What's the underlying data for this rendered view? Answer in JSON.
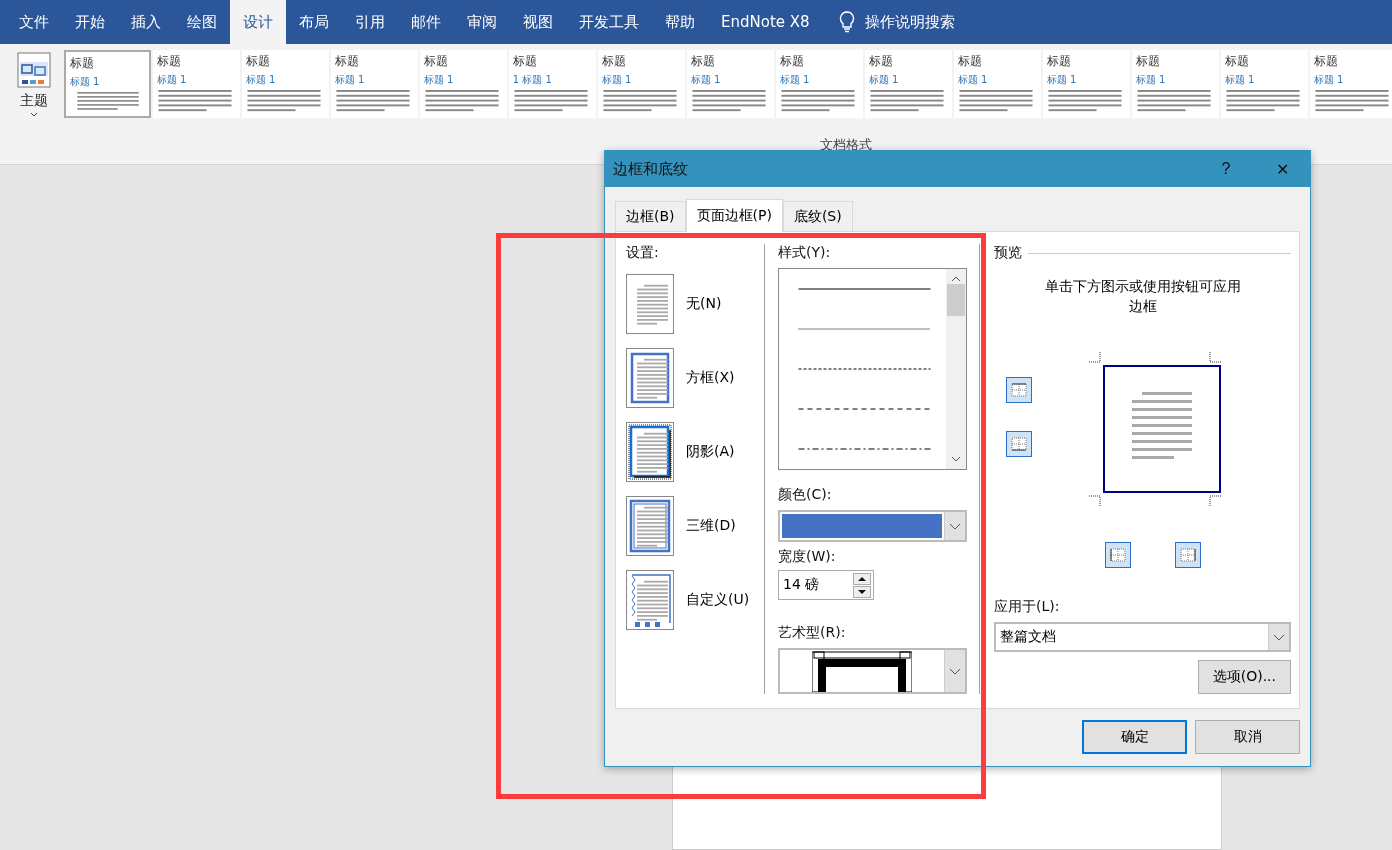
{
  "ribbon_tabs": [
    {
      "label": "文件",
      "selected": false
    },
    {
      "label": "开始",
      "selected": false
    },
    {
      "label": "插入",
      "selected": false
    },
    {
      "label": "绘图",
      "selected": false
    },
    {
      "label": "设计",
      "selected": true
    },
    {
      "label": "布局",
      "selected": false
    },
    {
      "label": "引用",
      "selected": false
    },
    {
      "label": "邮件",
      "selected": false
    },
    {
      "label": "审阅",
      "selected": false
    },
    {
      "label": "视图",
      "selected": false
    },
    {
      "label": "开发工具",
      "selected": false
    },
    {
      "label": "帮助",
      "selected": false
    },
    {
      "label": "EndNote X8",
      "selected": false
    }
  ],
  "tell_me": "操作说明搜索",
  "themes_button": "主题",
  "gallery": [
    {
      "title": "标题",
      "heading": "标题 1",
      "selected": true
    },
    {
      "title": "标题",
      "heading": "标题 1",
      "selected": false
    },
    {
      "title": "标题",
      "heading": "标题 1",
      "selected": false
    },
    {
      "title": "标题",
      "heading": "标题 1",
      "selected": false
    },
    {
      "title": "标题",
      "heading": "标题 1",
      "selected": false
    },
    {
      "title": "标题",
      "heading": "1 标题 1",
      "selected": false
    },
    {
      "title": "标题",
      "heading": "标题 1",
      "selected": false
    },
    {
      "title": "标题",
      "heading": "标题 1",
      "selected": false
    },
    {
      "title": "标题",
      "heading": "标题 1",
      "selected": false
    },
    {
      "title": "标题",
      "heading": "标题 1",
      "selected": false
    },
    {
      "title": "标题",
      "heading": "标题 1",
      "selected": false
    },
    {
      "title": "标题",
      "heading": "标题 1",
      "selected": false
    },
    {
      "title": "标题",
      "heading": "标题 1",
      "selected": false
    },
    {
      "title": "标题",
      "heading": "标题 1",
      "selected": false
    },
    {
      "title": "标题",
      "heading": "标题 1",
      "selected": false
    }
  ],
  "group_label": "文档格式",
  "dialog": {
    "title": "边框和底纹",
    "help": "?",
    "close": "✕",
    "tabs": [
      {
        "label": "边框(B)",
        "selected": false
      },
      {
        "label": "页面边框(P)",
        "selected": true
      },
      {
        "label": "底纹(S)",
        "selected": false
      }
    ],
    "settings_label": "设置:",
    "settings": [
      {
        "kind": "none",
        "label": "无(N)"
      },
      {
        "kind": "box",
        "label": "方框(X)"
      },
      {
        "kind": "shadow",
        "label": "阴影(A)"
      },
      {
        "kind": "three-d",
        "label": "三维(D)"
      },
      {
        "kind": "custom",
        "label": "自定义(U)"
      }
    ],
    "style_label": "样式(Y):",
    "styles": [
      {
        "kind": "solid"
      },
      {
        "kind": "dotted"
      },
      {
        "kind": "dashed"
      },
      {
        "kind": "long-dash"
      },
      {
        "kind": "dash-dot"
      }
    ],
    "color_label": "颜色(C):",
    "color": "#4472c4",
    "width_label": "宽度(W):",
    "width": "14 磅",
    "art_label": "艺术型(R):",
    "preview_label": "预览",
    "preview_hint": "单击下方图示或使用按钮可应用边框",
    "apply_label": "应用于(L):",
    "apply_value": "整篇文档",
    "options_button": "选项(O)...",
    "ok_button": "确定",
    "cancel_button": "取消"
  },
  "highlight_box": {
    "color": "#ff3b3b"
  }
}
